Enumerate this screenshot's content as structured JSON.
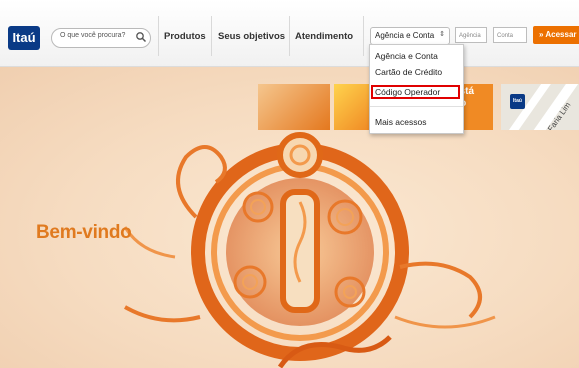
{
  "brand": {
    "logo_text": "Itaú",
    "accent": "#ec7000",
    "logo_bg": "#0a3a86"
  },
  "search": {
    "placeholder": "O que você procura?"
  },
  "nav": {
    "items": [
      {
        "label": "Produtos"
      },
      {
        "label": "Seus objetivos"
      },
      {
        "label": "Atendimento"
      }
    ]
  },
  "login": {
    "account_type": "Agência e Conta",
    "agencia_placeholder": "Agência",
    "conta_placeholder": "Conta",
    "submit_label": "» Acessar"
  },
  "dropdown": {
    "options": [
      {
        "label": "Agência e Conta"
      },
      {
        "label": "Cartão de Crédito"
      },
      {
        "label": "Código Operador"
      },
      {
        "label": "Mais acessos"
      }
    ],
    "highlighted": "Código Operador",
    "highlight_color": "#e00000"
  },
  "hero": {
    "welcome": "Bem-vindo",
    "tile_text": "está\ndo\n:-)",
    "map_label": "Faria Lim",
    "map_logo": "Itaú"
  }
}
